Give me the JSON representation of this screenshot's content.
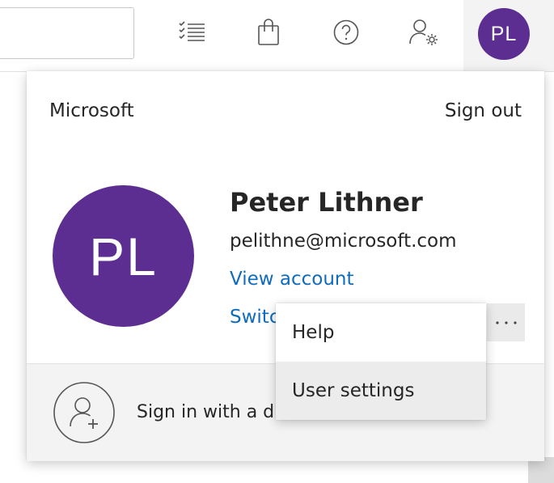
{
  "header": {
    "avatar_initials": "PL",
    "icons": [
      "tasks-list-icon",
      "shopping-bag-icon",
      "help-icon",
      "user-settings-icon"
    ]
  },
  "account": {
    "organization": "Microsoft",
    "sign_out_label": "Sign out",
    "initials": "PL",
    "name": "Peter Lithner",
    "email": "pelithne@microsoft.com",
    "view_account_label": "View account",
    "switch_label": "Switch directory",
    "more_label": "···",
    "add_account_label": "Sign in with a different account"
  },
  "context_menu": {
    "items": [
      {
        "label": "Help"
      },
      {
        "label": "User settings"
      }
    ]
  },
  "colors": {
    "avatar": "#5c2e91",
    "link": "#0f6cbd",
    "menu_hover": "#ececec"
  }
}
